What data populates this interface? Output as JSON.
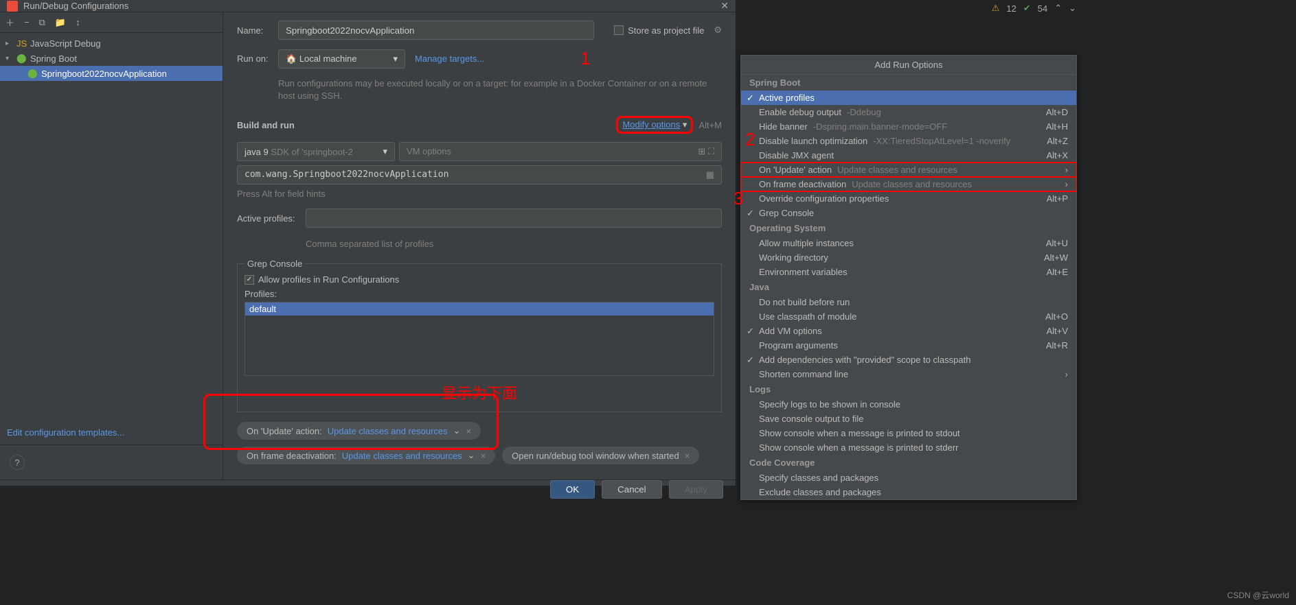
{
  "status": {
    "warn_icon": "⚠",
    "warn_count": "12",
    "ok_icon": "✔",
    "ok_count": "54"
  },
  "dialog": {
    "title": "Run/Debug Configurations",
    "close": "✕",
    "toolbar": {
      "add": "＋",
      "remove": "−",
      "copy": "⧉",
      "save": "📁",
      "sort": "↕"
    },
    "tree": {
      "js": "JavaScript Debug",
      "sb": "Spring Boot",
      "app": "Springboot2022nocvApplication"
    },
    "edit_templates": "Edit configuration templates...",
    "help": "?",
    "form": {
      "name_label": "Name:",
      "name_value": "Springboot2022nocvApplication",
      "store_label": "Store as project file",
      "gear": "⚙",
      "runon_label": "Run on:",
      "runon_value": "Local machine",
      "runon_icon": "🏠",
      "manage_targets": "Manage targets...",
      "runon_hint": "Run configurations may be executed locally or on a target: for example in a Docker Container or on a remote host using SSH.",
      "build_run": "Build and run",
      "modify_options": "Modify options",
      "modify_shortcut": "Alt+M",
      "sdk_prefix": "java 9",
      "sdk_suffix": " SDK of 'springboot-2",
      "vm_placeholder": "VM options",
      "main_class": "com.wang.Springboot2022nocvApplication",
      "field_hints": "Press Alt for field hints",
      "active_profiles_label": "Active profiles:",
      "comma_hint": "Comma separated list of profiles",
      "grep_title": "Grep Console",
      "allow_profiles": "Allow profiles in Run Configurations",
      "profiles_label": "Profiles:",
      "profile_item": "default",
      "cn_text": "显示为下面",
      "pill1_label": "On 'Update' action:",
      "pill1_value": "Update classes and resources",
      "pill2_label": "On frame deactivation:",
      "pill2_value": "Update classes and resources",
      "pill3_label": "Open run/debug tool window when started",
      "chevron": "⌄",
      "x": "×"
    },
    "buttons": {
      "ok": "OK",
      "cancel": "Cancel",
      "apply": "Apply"
    },
    "annotations": {
      "one": "1",
      "two": "2",
      "three": "3"
    }
  },
  "popup": {
    "title": "Add Run Options",
    "sections": {
      "spring": "Spring Boot",
      "os": "Operating System",
      "java": "Java",
      "logs": "Logs",
      "cov": "Code Coverage"
    },
    "items": {
      "active_profiles": "Active profiles",
      "enable_debug": {
        "l": "Enable debug output",
        "h": "-Ddebug",
        "s": "Alt+D"
      },
      "hide_banner": {
        "l": "Hide banner",
        "h": "-Dspring.main.banner-mode=OFF",
        "s": "Alt+H"
      },
      "disable_launch": {
        "l": "Disable launch optimization",
        "h": "-XX:TieredStopAtLevel=1 -noverify",
        "s": "Alt+Z"
      },
      "disable_jmx": {
        "l": "Disable JMX agent",
        "s": "Alt+X"
      },
      "on_update": {
        "l": "On 'Update' action",
        "h": "Update classes and resources"
      },
      "on_frame": {
        "l": "On frame deactivation",
        "h": "Update classes and resources"
      },
      "override_cfg": {
        "l": "Override configuration properties",
        "s": "Alt+P"
      },
      "grep_console": "Grep Console",
      "allow_multi": {
        "l": "Allow multiple instances",
        "s": "Alt+U"
      },
      "work_dir": {
        "l": "Working directory",
        "s": "Alt+W"
      },
      "env_vars": {
        "l": "Environment variables",
        "s": "Alt+E"
      },
      "no_build": "Do not build before run",
      "classpath": {
        "l": "Use classpath of module",
        "s": "Alt+O"
      },
      "vm_opts": {
        "l": "Add VM options",
        "s": "Alt+V"
      },
      "prog_args": {
        "l": "Program arguments",
        "s": "Alt+R"
      },
      "provided": "Add dependencies with \"provided\" scope to classpath",
      "shorten": "Shorten command line",
      "specify_logs": "Specify logs to be shown in console",
      "save_output": "Save console output to file",
      "sc_stdout": "Show console when a message is printed to stdout",
      "sc_stderr": "Show console when a message is printed to stderr",
      "specify_classes": "Specify classes and packages",
      "exclude_classes": "Exclude classes and packages"
    },
    "arrow": "›"
  },
  "watermark": "CSDN @云world"
}
